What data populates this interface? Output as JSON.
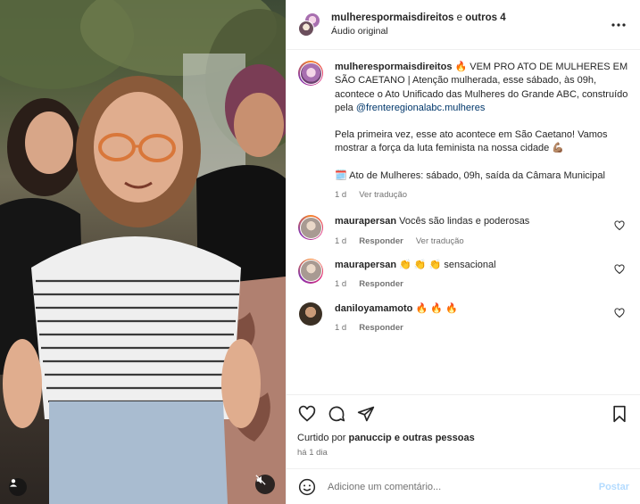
{
  "header": {
    "account": "mulherespormaisdireitos",
    "collab_text": "e",
    "others": "outros 4",
    "audio": "Áudio original"
  },
  "caption": {
    "username": "mulherespormaisdireitos",
    "p1_a": "🔥 VEM PRO ATO DE MULHERES EM SÃO CAETANO | Atenção mulherada, esse sábado, às 09h, acontece o Ato Unificado das Mulheres do Grande ABC, construído pela ",
    "mention": "@frenteregionalabc.mulheres",
    "p2": "Pela primeira vez, esse ato acontece em São Caetano! Vamos mostrar a força da luta feminista na nossa cidade 💪🏽",
    "p3": "🗓️ Ato de Mulheres: sábado, 09h, saída da Câmara Municipal",
    "time": "1 d",
    "translate": "Ver tradução"
  },
  "comments": [
    {
      "user": "maurapersan",
      "text": "Vocês são lindas e poderosas",
      "time": "1 d",
      "reply": "Responder",
      "translate": "Ver tradução"
    },
    {
      "user": "maurapersan",
      "text": "👏 👏 👏 sensacional",
      "time": "1 d",
      "reply": "Responder"
    },
    {
      "user": "daniloyamamoto",
      "text": "🔥 🔥 🔥",
      "time": "1 d",
      "reply": "Responder"
    }
  ],
  "likes": {
    "prefix": "Curtido por",
    "user": "panuccip",
    "suffix": "e outras pessoas"
  },
  "post_date": "há 1 dia",
  "comment_input": {
    "placeholder": "Adicione um comentário...",
    "post_label": "Postar"
  },
  "colors": {
    "link": "#00376b",
    "muted": "#737373",
    "post_disabled": "#b3dbff"
  }
}
